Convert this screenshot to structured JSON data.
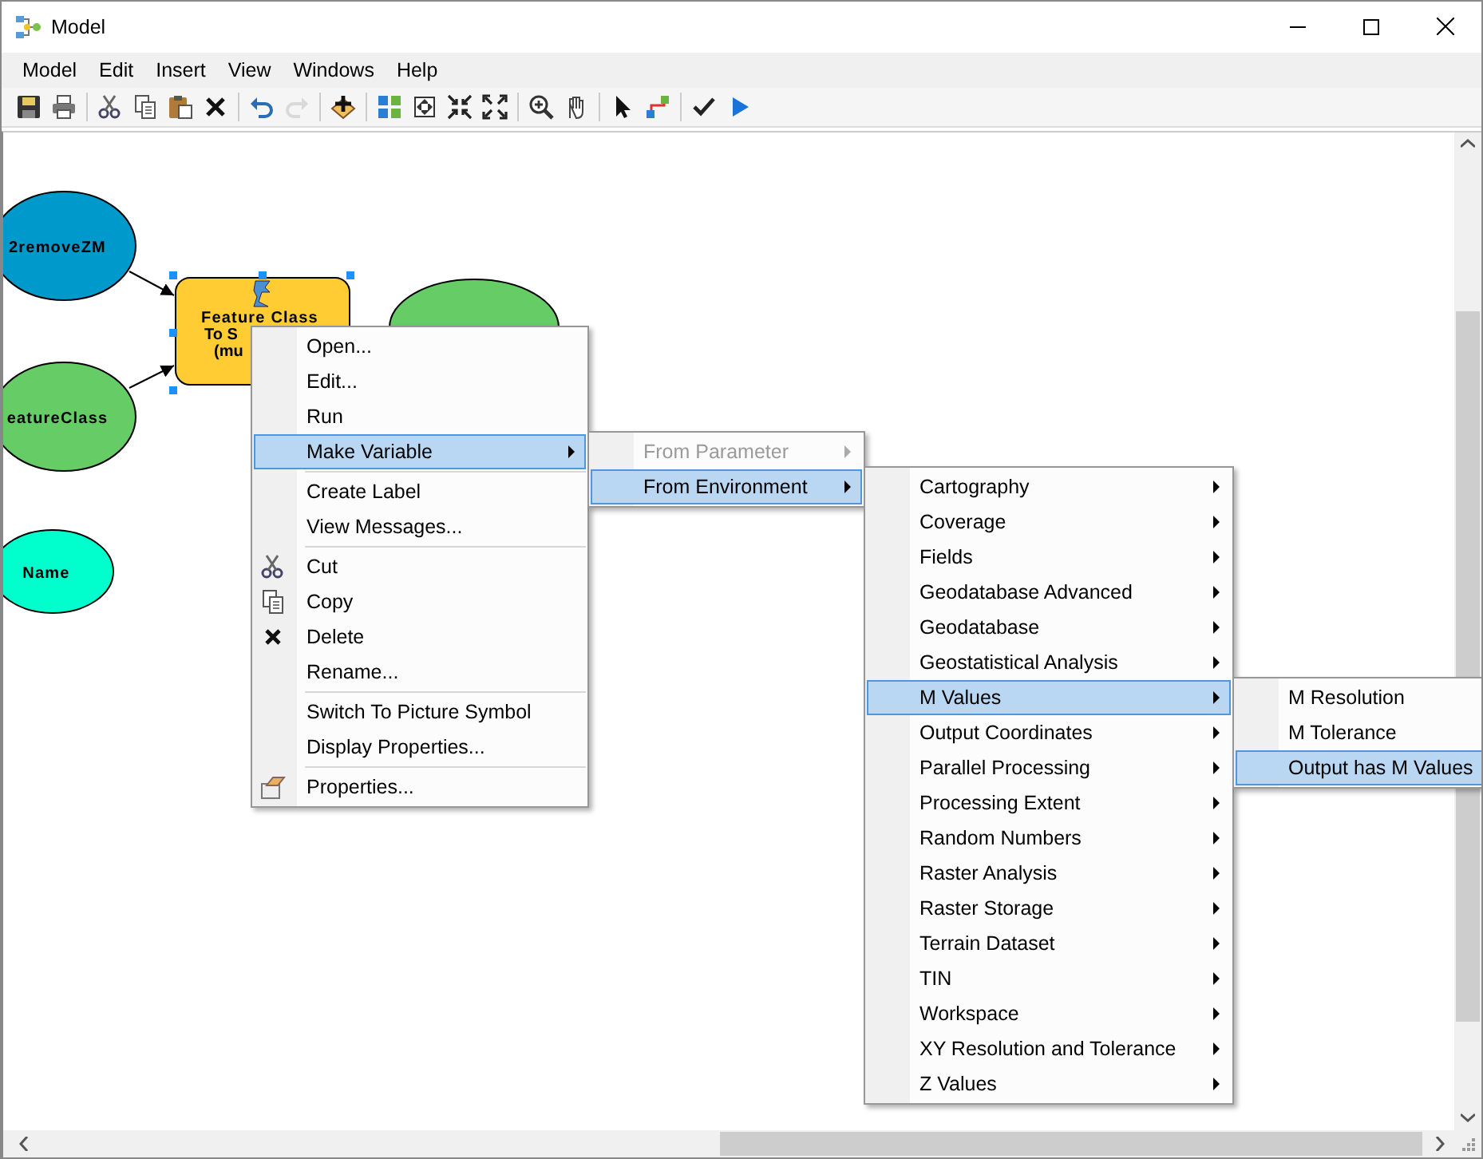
{
  "window": {
    "title": "Model"
  },
  "menu_bar": [
    "Model",
    "Edit",
    "Insert",
    "View",
    "Windows",
    "Help"
  ],
  "toolbar": [
    {
      "kind": "save",
      "disabled": false
    },
    {
      "kind": "print",
      "disabled": false
    },
    {
      "kind": "separator"
    },
    {
      "kind": "cut",
      "disabled": false
    },
    {
      "kind": "copy",
      "disabled": false
    },
    {
      "kind": "paste",
      "disabled": false
    },
    {
      "kind": "delete",
      "disabled": false
    },
    {
      "kind": "separator"
    },
    {
      "kind": "undo",
      "disabled": false
    },
    {
      "kind": "redo",
      "disabled": true
    },
    {
      "kind": "separator"
    },
    {
      "kind": "add",
      "disabled": false
    },
    {
      "kind": "separator"
    },
    {
      "kind": "layout",
      "disabled": false
    },
    {
      "kind": "extent",
      "disabled": false
    },
    {
      "kind": "shrink",
      "disabled": false
    },
    {
      "kind": "expand",
      "disabled": false
    },
    {
      "kind": "separator"
    },
    {
      "kind": "zoom",
      "disabled": false
    },
    {
      "kind": "pan",
      "disabled": false
    },
    {
      "kind": "separator"
    },
    {
      "kind": "select",
      "disabled": false
    },
    {
      "kind": "connect",
      "disabled": false
    },
    {
      "kind": "separator"
    },
    {
      "kind": "validate",
      "disabled": false
    },
    {
      "kind": "run",
      "disabled": false
    }
  ],
  "model_nodes": [
    {
      "kind": "ellipse",
      "label": "2removeZM",
      "color": "#0099cc"
    },
    {
      "kind": "ellipse",
      "label": "eatureClass",
      "color": "#66cc66"
    },
    {
      "kind": "ellipse",
      "label": "Name",
      "color": "#00ffcc"
    },
    {
      "kind": "ellipse",
      "color": "#66cc66"
    },
    {
      "kind": "tool",
      "lines": [
        "Feature Class",
        "To S",
        "(mu"
      ],
      "color": "#ffcc33",
      "selected": true
    }
  ],
  "context_menu": {
    "items": [
      {
        "label": "Open...",
        "selected": false
      },
      {
        "label": "Edit...",
        "selected": false
      },
      {
        "label": "Run",
        "selected": false
      },
      {
        "label": "Make Variable",
        "selected": true,
        "has_submenu": true,
        "submenu": {
          "items": [
            {
              "label": "From Parameter",
              "selected": false,
              "disabled": true,
              "has_submenu": true
            },
            {
              "label": "From Environment",
              "selected": true,
              "disabled": false,
              "has_submenu": true,
              "submenu": {
                "items": [
                  {
                    "label": "Cartography",
                    "selected": false,
                    "has_submenu": true
                  },
                  {
                    "label": "Coverage",
                    "selected": false,
                    "has_submenu": true
                  },
                  {
                    "label": "Fields",
                    "selected": false,
                    "has_submenu": true
                  },
                  {
                    "label": "Geodatabase Advanced",
                    "selected": false,
                    "has_submenu": true
                  },
                  {
                    "label": "Geodatabase",
                    "selected": false,
                    "has_submenu": true
                  },
                  {
                    "label": "Geostatistical Analysis",
                    "selected": false,
                    "has_submenu": true
                  },
                  {
                    "label": "M Values",
                    "selected": true,
                    "has_submenu": true,
                    "submenu": {
                      "items": [
                        {
                          "label": "M Resolution",
                          "selected": false
                        },
                        {
                          "label": "M Tolerance",
                          "selected": false
                        },
                        {
                          "label": "Output has M Values",
                          "selected": true
                        }
                      ]
                    }
                  },
                  {
                    "label": "Output Coordinates",
                    "selected": false,
                    "has_submenu": true
                  },
                  {
                    "label": "Parallel Processing",
                    "selected": false,
                    "has_submenu": true
                  },
                  {
                    "label": "Processing Extent",
                    "selected": false,
                    "has_submenu": true
                  },
                  {
                    "label": "Random Numbers",
                    "selected": false,
                    "has_submenu": true
                  },
                  {
                    "label": "Raster Analysis",
                    "selected": false,
                    "has_submenu": true
                  },
                  {
                    "label": "Raster Storage",
                    "selected": false,
                    "has_submenu": true
                  },
                  {
                    "label": "Terrain Dataset",
                    "selected": false,
                    "has_submenu": true
                  },
                  {
                    "label": "TIN",
                    "selected": false,
                    "has_submenu": true
                  },
                  {
                    "label": "Workspace",
                    "selected": false,
                    "has_submenu": true
                  },
                  {
                    "label": "XY Resolution and Tolerance",
                    "selected": false,
                    "has_submenu": true
                  },
                  {
                    "label": "Z Values",
                    "selected": false,
                    "has_submenu": true
                  }
                ]
              }
            }
          ]
        }
      },
      {
        "label": "Create Label",
        "selected": false,
        "separator_before": true
      },
      {
        "label": "View Messages...",
        "selected": false
      },
      {
        "label": "Cut",
        "selected": false,
        "separator_before": true
      },
      {
        "label": "Copy",
        "selected": false
      },
      {
        "label": "Delete",
        "selected": false
      },
      {
        "label": "Rename...",
        "selected": false
      },
      {
        "label": "Switch To Picture Symbol",
        "selected": false,
        "separator_before": true
      },
      {
        "label": "Display Properties...",
        "selected": false
      },
      {
        "label": "Properties...",
        "selected": false,
        "separator_before": true
      }
    ]
  }
}
